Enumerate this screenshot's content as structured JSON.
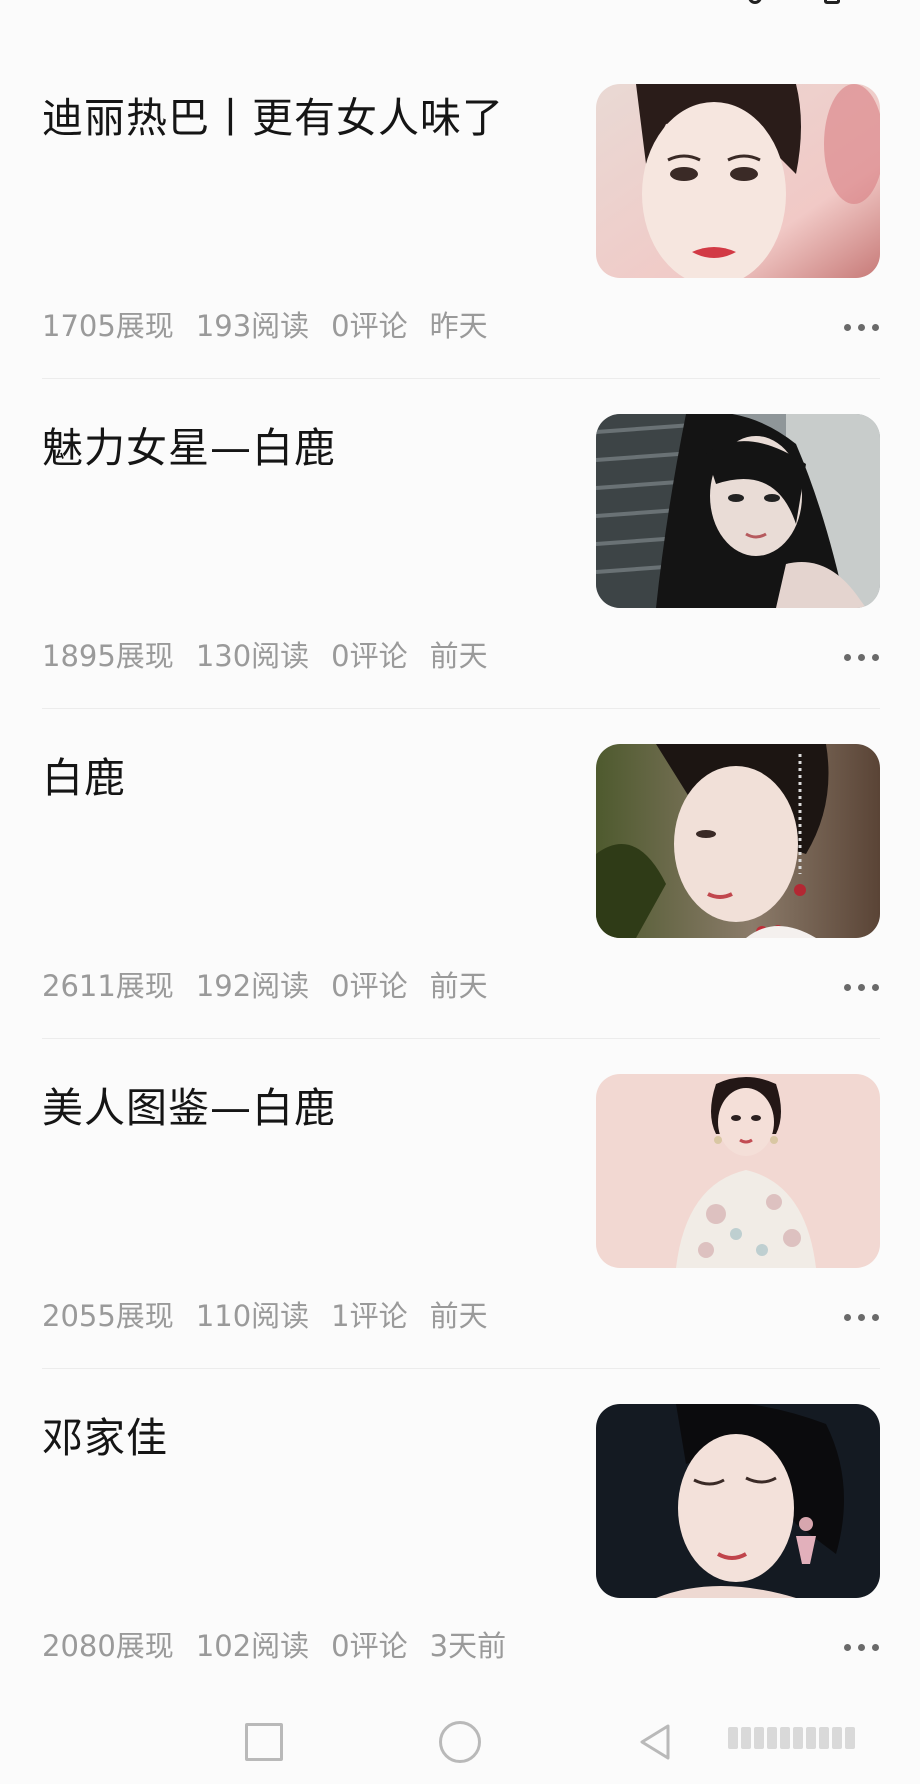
{
  "articles": [
    {
      "title": "迪丽热巴丨更有女人味了",
      "impressions": "1705展现",
      "reads": "193阅读",
      "comments": "0评论",
      "time": "昨天"
    },
    {
      "title": "魅力女星—白鹿",
      "impressions": "1895展现",
      "reads": "130阅读",
      "comments": "0评论",
      "time": "前天"
    },
    {
      "title": "白鹿",
      "impressions": "2611展现",
      "reads": "192阅读",
      "comments": "0评论",
      "time": "前天"
    },
    {
      "title": "美人图鉴—白鹿",
      "impressions": "2055展现",
      "reads": "110阅读",
      "comments": "1评论",
      "time": "前天"
    },
    {
      "title": "邓家佳",
      "impressions": "2080展现",
      "reads": "102阅读",
      "comments": "0评论",
      "time": "3天前"
    }
  ],
  "icons": {
    "more": "more-dots-icon",
    "nav_recent": "square-icon",
    "nav_home": "circle-icon",
    "nav_back": "triangle-back-icon"
  },
  "colors": {
    "background": "#fbfbfb",
    "title": "#151515",
    "meta": "#9a9a9a",
    "divider": "#ececec",
    "nav_icon": "#b9b9b9"
  }
}
